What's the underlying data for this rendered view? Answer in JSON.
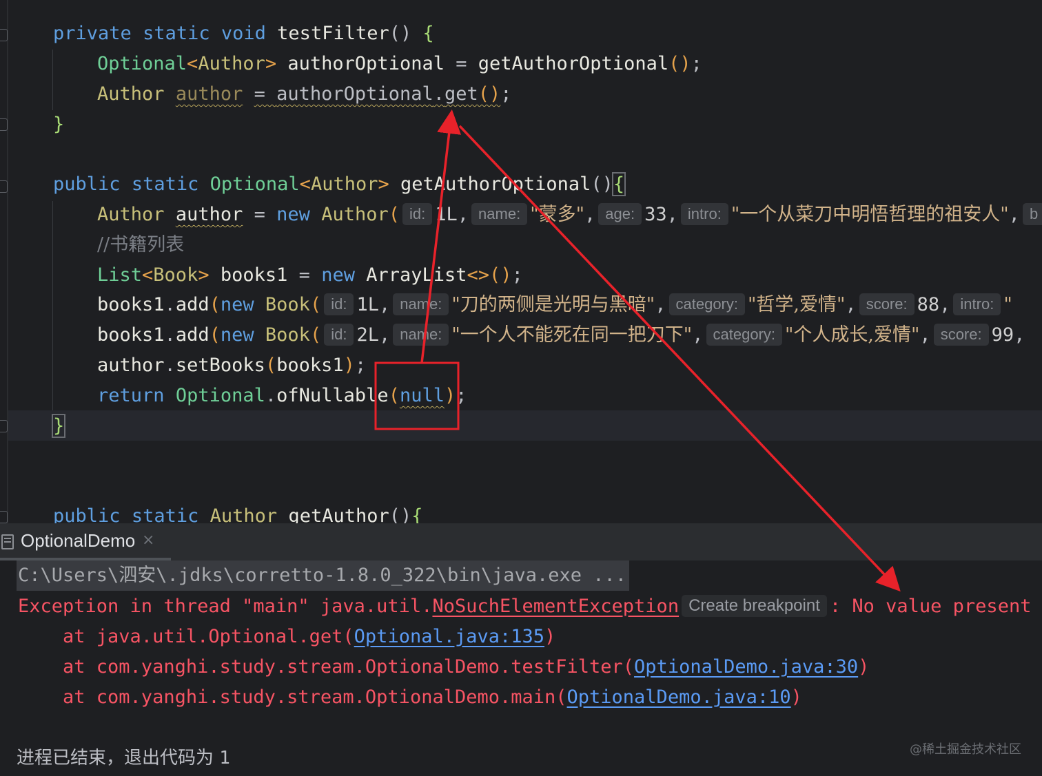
{
  "editor": {
    "kw": {
      "private": "private",
      "public": "public",
      "static": "static",
      "void": "void",
      "new": "new",
      "return": "return",
      "null": "null"
    },
    "types": {
      "optional": "Optional",
      "author": "Author",
      "list": "List",
      "book": "Book",
      "arraylist": "ArrayList"
    },
    "idents": {
      "testFilter": "testFilter",
      "authorOptional": "authorOptional",
      "getAuthorOptional": "getAuthorOptional",
      "author": "author",
      "get": "get",
      "books1": "books1",
      "add": "add",
      "setBooks": "setBooks",
      "ofNullable": "ofNullable",
      "getAuthor": "getAuthor"
    },
    "hints": {
      "id": "id:",
      "name": "name:",
      "age": "age:",
      "intro": "intro:",
      "category": "category:",
      "score": "score:",
      "cut": "b"
    },
    "literals": {
      "one": "1L",
      "two": "2L",
      "age": "33",
      "s88": "88",
      "s99": "99",
      "name1": "\"蒙多\"",
      "intro1": "\"一个从菜刀中明悟哲理的祖安人\"",
      "book1_name": "\"刀的两侧是光明与黑暗\"",
      "book1_cat": "\"哲学,爱情\"",
      "book1_intro": "\"",
      "book2_name": "\"一个人不能死在同一把刀下\"",
      "book2_cat": "\"个人成长,爱情\""
    },
    "comment": "//书籍列表"
  },
  "run_panel": {
    "tab_label": "OptionalDemo",
    "close_glyph": "×"
  },
  "console": {
    "command": "C:\\Users\\泗安\\.jdks\\corretto-1.8.0_322\\bin\\java.exe ...",
    "exception_prefix": "Exception in thread \"main\" java.util.",
    "exception_class": "NoSuchElementException",
    "create_breakpoint": "Create breakpoint",
    "exception_suffix": ": No value present",
    "trace": [
      {
        "prefix": "    at java.util.Optional.get(",
        "link": "Optional.java:135",
        "suffix": ")"
      },
      {
        "prefix": "    at com.yanghi.study.stream.OptionalDemo.testFilter(",
        "link": "OptionalDemo.java:30",
        "suffix": ")"
      },
      {
        "prefix": "    at com.yanghi.study.stream.OptionalDemo.main(",
        "link": "OptionalDemo.java:10",
        "suffix": ")"
      }
    ],
    "exit_text": "进程已结束，退出代码为 ",
    "exit_code": "1"
  },
  "watermark": "@稀土掘金技术社区",
  "annotation_color": "#e8222a"
}
